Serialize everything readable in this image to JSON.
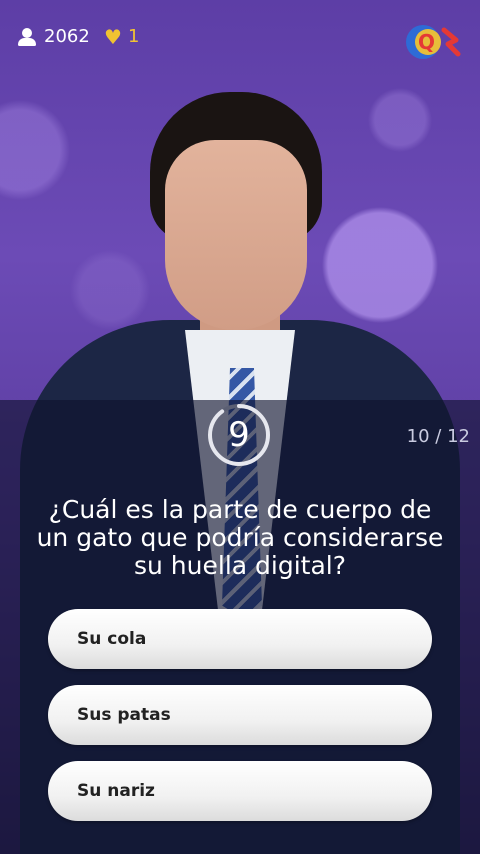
{
  "header": {
    "viewer_count": "2062",
    "lives_count": "1",
    "logo_letter": "Q"
  },
  "game": {
    "timer": "9",
    "timer_fraction_remaining": 0.9,
    "progress": "10 / 12",
    "question": "¿Cuál es la parte de cuerpo de un gato que podría considerarse su huella digital?",
    "answers": [
      "Su cola",
      "Sus patas",
      "Su nariz"
    ]
  },
  "colors": {
    "accent_gold": "#f1c232",
    "logo_blue": "#2e6bd6",
    "logo_red": "#e53935",
    "logo_yellow": "#f1c232"
  },
  "icons": {
    "viewers": "user-icon",
    "lives": "heart-icon"
  }
}
